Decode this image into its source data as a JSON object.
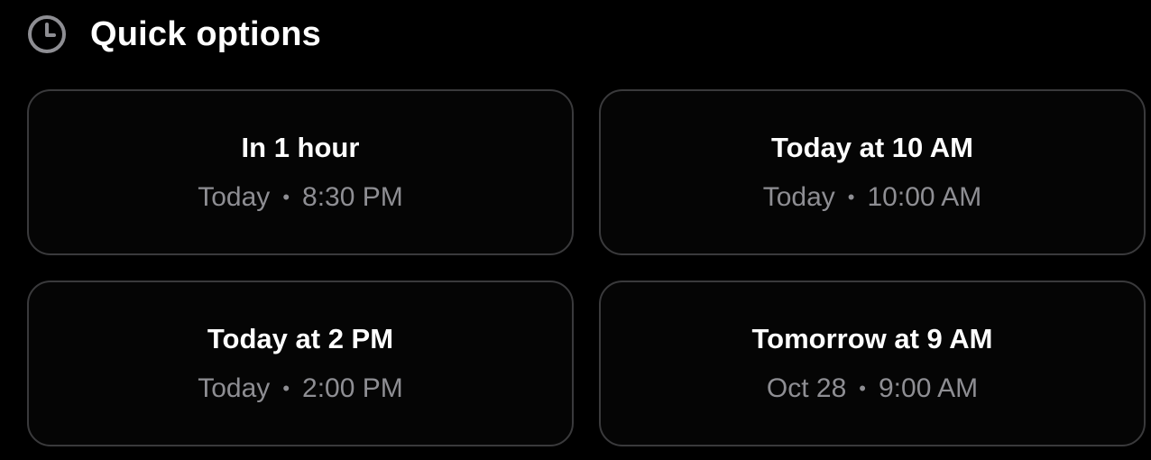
{
  "header": {
    "title": "Quick options",
    "icon": "clock-icon"
  },
  "options": [
    {
      "title": "In 1 hour",
      "day": "Today",
      "time": "8:30 PM"
    },
    {
      "title": "Today at 10 AM",
      "day": "Today",
      "time": "10:00 AM"
    },
    {
      "title": "Today at 2 PM",
      "day": "Today",
      "time": "2:00 PM"
    },
    {
      "title": "Tomorrow at 9 AM",
      "day": "Oct 28",
      "time": "9:00 AM"
    }
  ],
  "separator": "•",
  "colors": {
    "background": "#000000",
    "card_border": "#3a3a3c",
    "primary_text": "#ffffff",
    "secondary_text": "#8e8e93"
  }
}
